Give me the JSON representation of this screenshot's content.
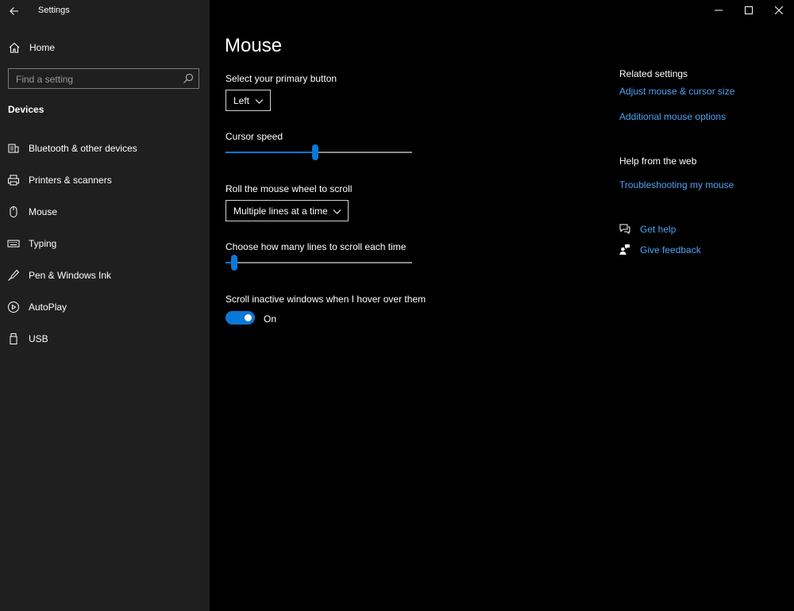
{
  "app": {
    "title": "Settings"
  },
  "sidebar": {
    "home_label": "Home",
    "search_placeholder": "Find a setting",
    "section": "Devices",
    "items": [
      {
        "label": "Bluetooth & other devices",
        "icon": "bluetooth-devices-icon"
      },
      {
        "label": "Printers & scanners",
        "icon": "printer-icon"
      },
      {
        "label": "Mouse",
        "icon": "mouse-icon"
      },
      {
        "label": "Typing",
        "icon": "keyboard-icon"
      },
      {
        "label": "Pen & Windows Ink",
        "icon": "pen-icon"
      },
      {
        "label": "AutoPlay",
        "icon": "autoplay-icon"
      },
      {
        "label": "USB",
        "icon": "usb-icon"
      }
    ]
  },
  "main": {
    "title": "Mouse",
    "primary_button": {
      "label": "Select your primary button",
      "value": "Left"
    },
    "cursor_speed": {
      "label": "Cursor speed",
      "value_fraction": 0.48
    },
    "wheel_scroll": {
      "label": "Roll the mouse wheel to scroll",
      "value": "Multiple lines at a time"
    },
    "lines_to_scroll": {
      "label": "Choose how many lines to scroll each time",
      "value_fraction": 0.03
    },
    "scroll_inactive": {
      "label": "Scroll inactive windows when I hover over them",
      "state": "On",
      "on": true
    }
  },
  "related": {
    "heading": "Related settings",
    "links": [
      "Adjust mouse & cursor size",
      "Additional mouse options"
    ]
  },
  "web_help": {
    "heading": "Help from the web",
    "links": [
      "Troubleshooting my mouse"
    ]
  },
  "support": {
    "get_help": "Get help",
    "give_feedback": "Give feedback"
  },
  "colors": {
    "accent": "#0a78d7",
    "link": "#4ea1f0",
    "sidebar_bg": "#1f1f1f",
    "content_bg": "#000000"
  }
}
